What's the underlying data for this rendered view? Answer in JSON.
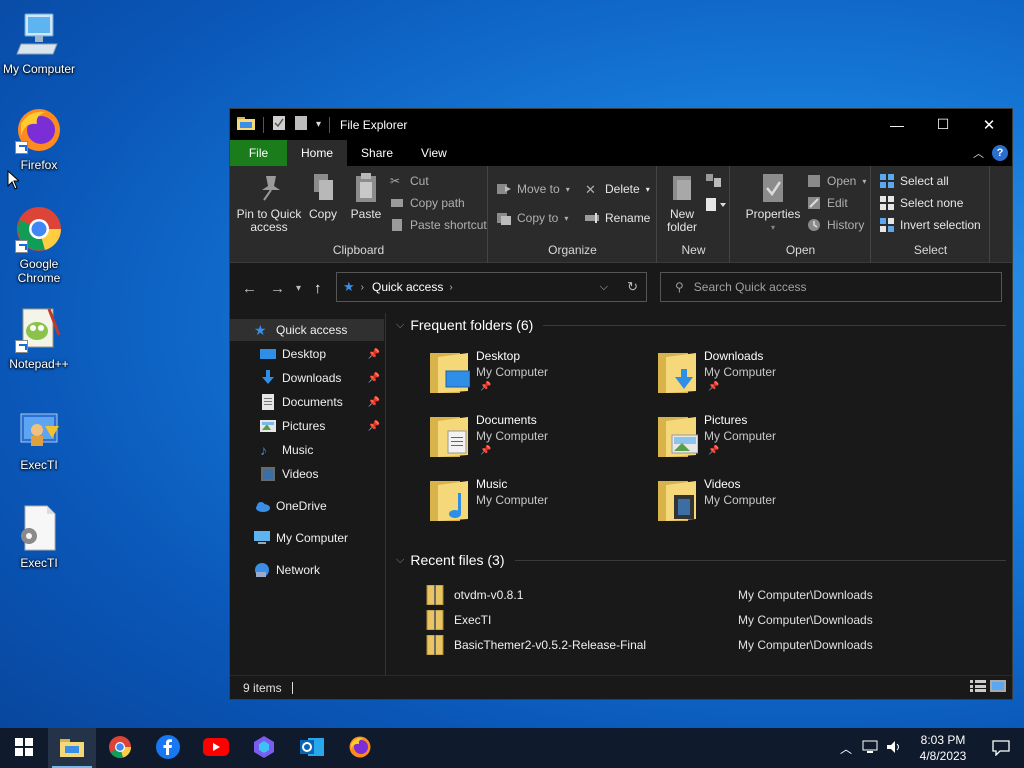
{
  "desktop": {
    "icons": [
      {
        "label": "My Computer",
        "icon": "computer-icon"
      },
      {
        "label": "Firefox",
        "icon": "firefox-icon"
      },
      {
        "label": "Google Chrome",
        "icon": "chrome-icon"
      },
      {
        "label": "Notepad++",
        "icon": "notepadpp-icon"
      },
      {
        "label": "ExecTI",
        "icon": "execti-icon"
      },
      {
        "label": "ExecTI",
        "icon": "execti-file-icon"
      }
    ]
  },
  "window": {
    "title": "File Explorer",
    "controls": {
      "minimize": "—",
      "maximize": "☐",
      "close": "✕"
    }
  },
  "ribbon_tabs": [
    "File",
    "Home",
    "Share",
    "View"
  ],
  "ribbon": {
    "clipboard": {
      "label": "Clipboard",
      "pin": "Pin to Quick access",
      "copy": "Copy",
      "paste": "Paste",
      "cut": "Cut",
      "copy_path": "Copy path",
      "paste_shortcut": "Paste shortcut"
    },
    "organize": {
      "label": "Organize",
      "move_to": "Move to",
      "copy_to": "Copy to",
      "delete": "Delete",
      "rename": "Rename"
    },
    "new": {
      "label": "New",
      "new_folder": "New folder"
    },
    "open": {
      "label": "Open",
      "properties": "Properties",
      "open": "Open",
      "edit": "Edit",
      "history": "History"
    },
    "select": {
      "label": "Select",
      "select_all": "Select all",
      "select_none": "Select none",
      "invert": "Invert selection"
    }
  },
  "address": {
    "path": "Quick access",
    "search_placeholder": "Search Quick access"
  },
  "nav": {
    "quick_access": "Quick access",
    "items": [
      {
        "label": "Desktop",
        "pinned": true
      },
      {
        "label": "Downloads",
        "pinned": true
      },
      {
        "label": "Documents",
        "pinned": true
      },
      {
        "label": "Pictures",
        "pinned": true
      },
      {
        "label": "Music",
        "pinned": false
      },
      {
        "label": "Videos",
        "pinned": false
      }
    ],
    "onedrive": "OneDrive",
    "computer": "My Computer",
    "network": "Network"
  },
  "frequent": {
    "header": "Frequent folders (6)",
    "folders": [
      {
        "name": "Desktop",
        "location": "My Computer",
        "pinned": true
      },
      {
        "name": "Downloads",
        "location": "My Computer",
        "pinned": true
      },
      {
        "name": "Documents",
        "location": "My Computer",
        "pinned": true
      },
      {
        "name": "Pictures",
        "location": "My Computer",
        "pinned": true
      },
      {
        "name": "Music",
        "location": "My Computer",
        "pinned": false
      },
      {
        "name": "Videos",
        "location": "My Computer",
        "pinned": false
      }
    ]
  },
  "recent": {
    "header": "Recent files (3)",
    "files": [
      {
        "name": "otvdm-v0.8.1",
        "path": "My Computer\\Downloads"
      },
      {
        "name": "ExecTI",
        "path": "My Computer\\Downloads"
      },
      {
        "name": "BasicThemer2-v0.5.2-Release-Final",
        "path": "My Computer\\Downloads"
      }
    ]
  },
  "status": {
    "items": "9 items"
  },
  "taskbar": {
    "apps": [
      "start-icon",
      "file-explorer-icon",
      "chrome-icon",
      "facebook-icon",
      "youtube-icon",
      "azure-icon",
      "outlook-icon",
      "firefox-icon"
    ],
    "time": "8:03 PM",
    "date": "4/8/2023"
  },
  "colors": {
    "file_tab": "#1a7c1a",
    "window_bg": "#191919",
    "ribbon_bg": "#2b2b2b",
    "accent": "#2a6fd0",
    "folder": "#f5d87a"
  }
}
